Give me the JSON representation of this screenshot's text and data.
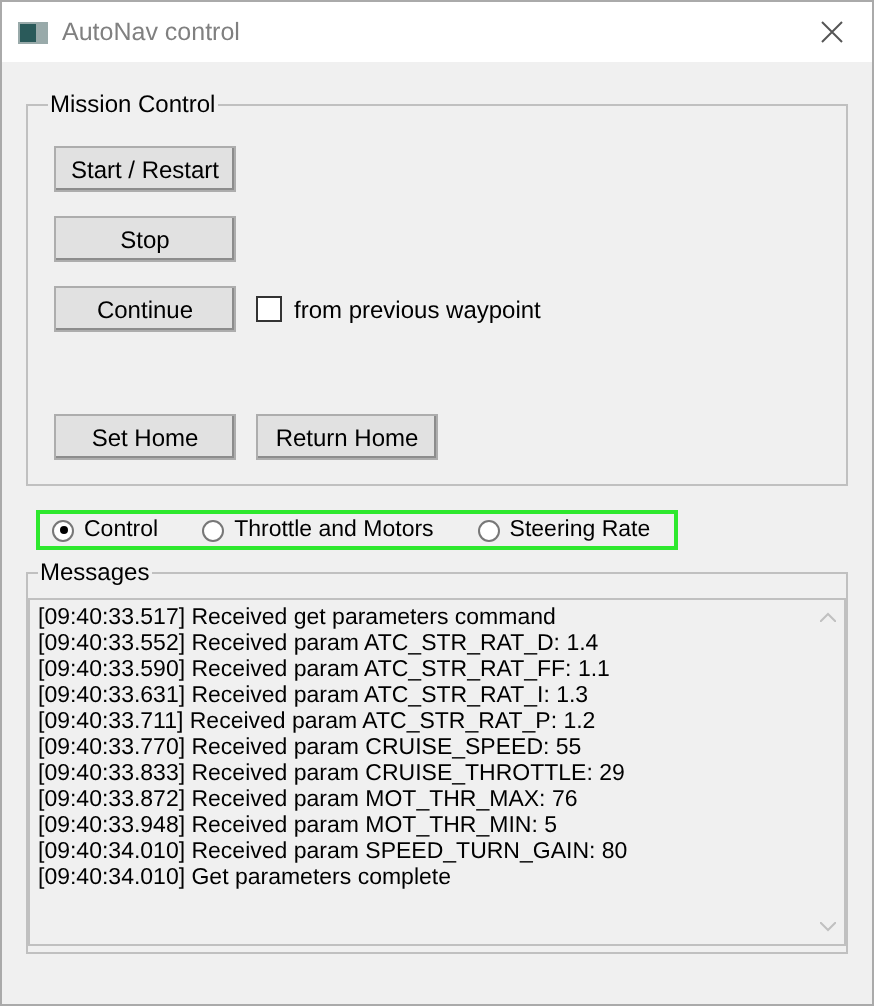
{
  "window": {
    "title": "AutoNav control"
  },
  "mission_control": {
    "title": "Mission Control",
    "buttons": [
      {
        "label": "Start / Restart"
      },
      {
        "label": "Stop"
      },
      {
        "label": "Continue"
      }
    ],
    "option": {
      "label": "from previous waypoint",
      "checked": false
    },
    "home_buttons": [
      {
        "label": "Set Home"
      },
      {
        "label": "Return Home"
      }
    ]
  },
  "modes": [
    {
      "label": "Control",
      "selected": true
    },
    {
      "label": "Throttle and Motors",
      "selected": false
    },
    {
      "label": "Steering Rate",
      "selected": false
    }
  ],
  "messages": {
    "title": "Messages",
    "lines": [
      "[09:40:33.517] Received get parameters command",
      "[09:40:33.552] Received param ATC_STR_RAT_D: 1.4",
      "[09:40:33.590] Received param ATC_STR_RAT_FF: 1.1",
      "[09:40:33.631] Received param ATC_STR_RAT_I: 1.3",
      "[09:40:33.711] Received param ATC_STR_RAT_P: 1.2",
      "[09:40:33.770] Received param CRUISE_SPEED: 55",
      "[09:40:33.833] Received param CRUISE_THROTTLE: 29",
      "[09:40:33.872] Received param MOT_THR_MAX: 76",
      "[09:40:33.948] Received param MOT_THR_MIN: 5",
      "[09:40:34.010] Received param SPEED_TURN_GAIN: 80",
      "[09:40:34.010] Get parameters complete"
    ]
  }
}
